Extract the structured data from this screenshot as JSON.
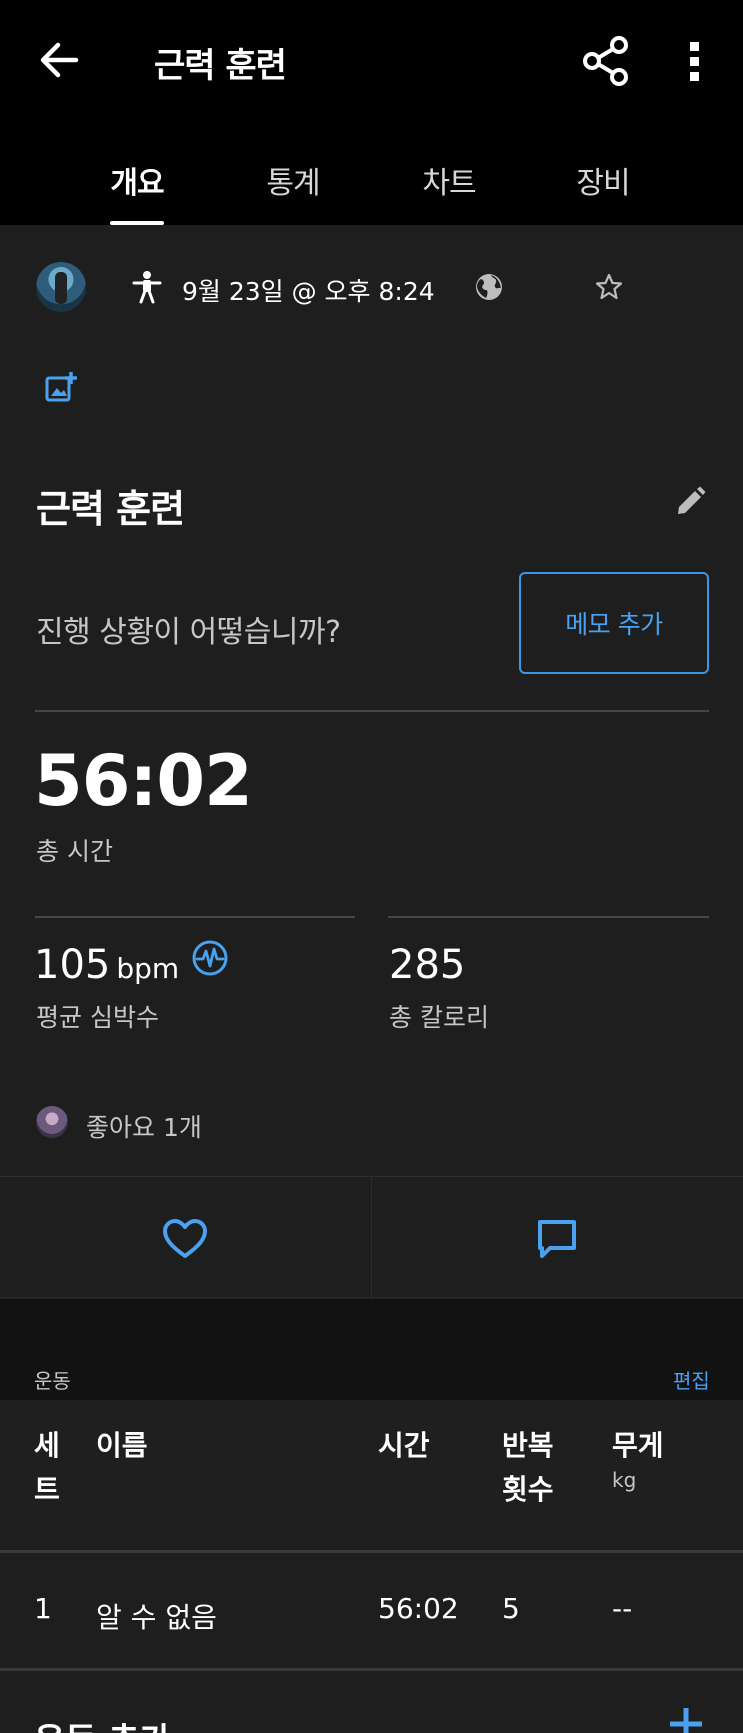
{
  "header": {
    "title": "근력 훈련",
    "tabs": [
      "개요",
      "통계",
      "차트",
      "장비"
    ],
    "active_tab": 0
  },
  "activity": {
    "date": "9월 23일 @ 오후 8:24",
    "name": "근력 훈련",
    "prompt": "진행 상황이 어떻습니까?",
    "memo_button": "메모 추가"
  },
  "stats": {
    "total_time": {
      "value": "56:02",
      "label": "총 시간"
    },
    "avg_hr": {
      "value": "105",
      "unit": "bpm",
      "label": "평균 심박수"
    },
    "calories": {
      "value": "285",
      "label": "총 칼로리"
    }
  },
  "social": {
    "likes_text": "좋아요 1개"
  },
  "exercises": {
    "section_label": "운동",
    "edit_label": "편집",
    "columns": {
      "set": "세트",
      "name": "이름",
      "time": "시간",
      "reps": "반복 횟수",
      "weight": "무게",
      "weight_unit": "kg"
    },
    "rows": [
      {
        "set": "1",
        "name": "알 수 없음",
        "time": "56:02",
        "reps": "5",
        "weight": "--"
      }
    ],
    "add_label": "운동 추가"
  },
  "colors": {
    "accent": "#4aa1f0",
    "header_bg": "#000000",
    "body_bg": "#1e1e1e"
  }
}
